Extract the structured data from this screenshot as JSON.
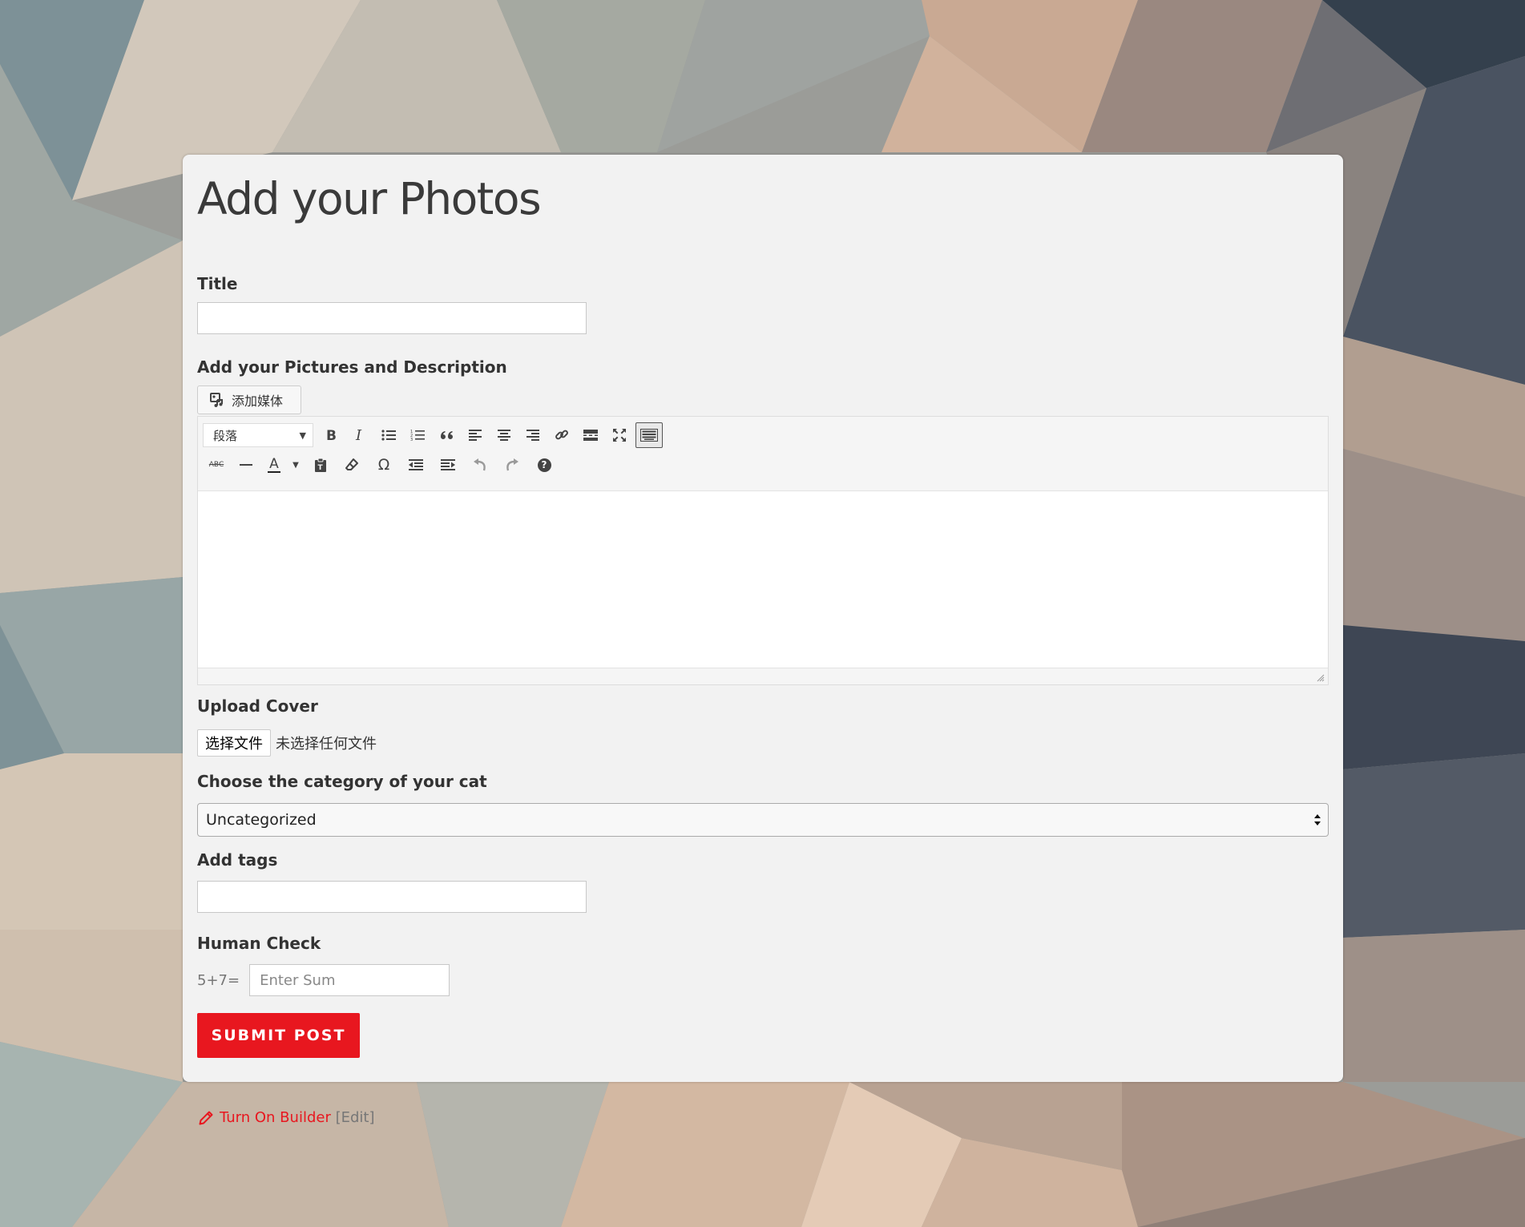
{
  "page": {
    "title": "Add your Photos"
  },
  "form": {
    "title_label": "Title",
    "title_value": "",
    "description_label": "Add your Pictures and Description",
    "add_media_label": "添加媒体",
    "editor": {
      "format_select": "段落",
      "row1_tools": [
        "bold-icon",
        "italic-icon",
        "bulleted-list-icon",
        "numbered-list-icon",
        "blockquote-icon",
        "align-left-icon",
        "align-center-icon",
        "align-right-icon",
        "link-icon",
        "read-more-icon",
        "fullscreen-icon",
        "toolbar-toggle-icon"
      ],
      "row2_tools": [
        "strikethrough-icon",
        "horizontal-line-icon",
        "text-color-icon",
        "paste-as-text-icon",
        "clear-formatting-icon",
        "special-character-icon",
        "outdent-icon",
        "indent-icon",
        "undo-icon",
        "redo-icon",
        "help-icon"
      ],
      "strike_glyph": "ABC",
      "text_color_glyph": "A",
      "omega_glyph": "Ω",
      "help_glyph": "?",
      "content": ""
    },
    "cover_label": "Upload Cover",
    "file_button": "选择文件",
    "file_status": "未选择任何文件",
    "category_label": "Choose the category of your cat",
    "category_value": "Uncategorized",
    "tags_label": "Add tags",
    "tags_value": "",
    "human_check_label": "Human Check",
    "captcha_question": "5+7=",
    "captcha_placeholder": "Enter Sum",
    "submit_label": "SUBMIT POST"
  },
  "footer": {
    "builder_link": "Turn On Builder",
    "edit_link": "Edit",
    "bracket_open": "[",
    "bracket_close": "]",
    "icon": "pencil-icon"
  },
  "colors": {
    "accent": "#e8171f",
    "card_bg": "#f2f2f2"
  }
}
